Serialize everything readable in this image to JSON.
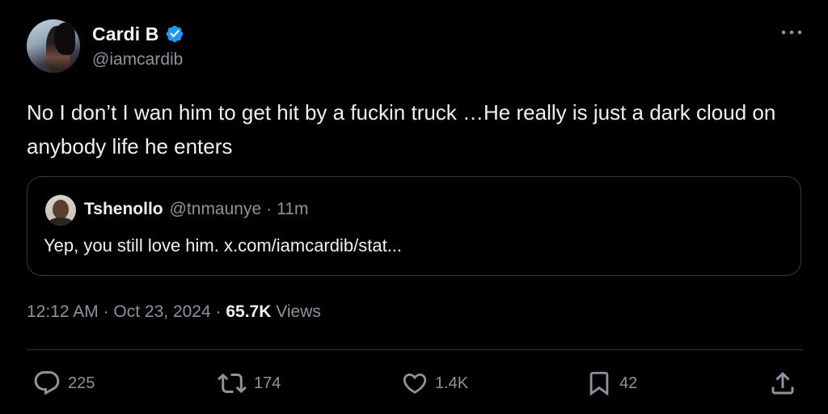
{
  "author": {
    "display_name": "Cardi B",
    "handle": "@iamcardib",
    "verified": true,
    "verified_color": "#1d9bf0"
  },
  "tweet": {
    "text": "No I don’t I wan him to get hit by a fuckin truck …He really is just a dark cloud on anybody life he enters"
  },
  "quoted_tweet": {
    "display_name": "Tshenollo",
    "handle": "@tnmaunye",
    "separator": "·",
    "time": "11m",
    "text": "Yep, you still love him. x.com/iamcardib/stat..."
  },
  "meta": {
    "time": "12:12 AM",
    "sep1": "·",
    "date": "Oct 23, 2024",
    "sep2": "·",
    "views_count": "65.7K",
    "views_label": "Views"
  },
  "actions": {
    "replies": "225",
    "reposts": "174",
    "likes": "1.4K",
    "bookmarks": "42"
  },
  "icons": {
    "more": "more-horizontal-icon",
    "reply": "reply-icon",
    "repost": "repost-icon",
    "like": "heart-icon",
    "bookmark": "bookmark-icon",
    "share": "share-icon"
  },
  "colors": {
    "background": "#000000",
    "text": "#e7e9ea",
    "secondary": "#8b949c",
    "border": "#343a40"
  }
}
